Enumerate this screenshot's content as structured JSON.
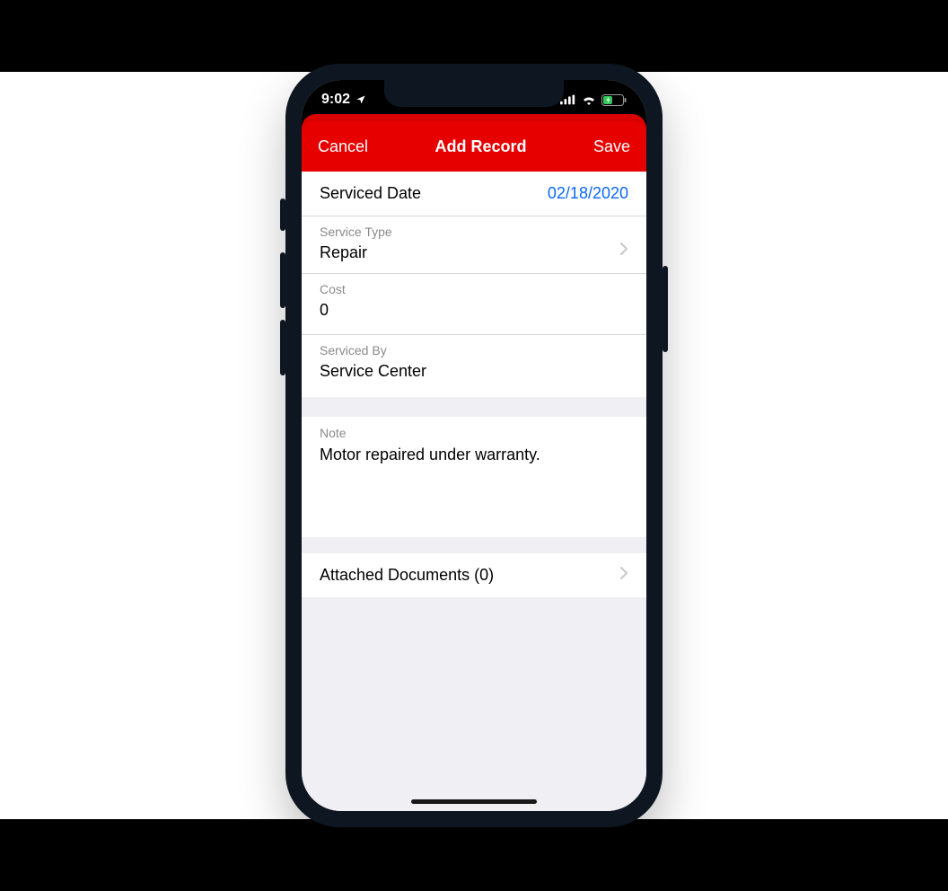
{
  "statusbar": {
    "time": "9:02"
  },
  "nav": {
    "cancel_label": "Cancel",
    "title": "Add Record",
    "save_label": "Save"
  },
  "fields": {
    "serviced_date": {
      "label": "Serviced Date",
      "value": "02/18/2020"
    },
    "service_type": {
      "label": "Service Type",
      "value": "Repair"
    },
    "cost": {
      "label": "Cost",
      "value": "0"
    },
    "serviced_by": {
      "label": "Serviced By",
      "value": "Service Center"
    },
    "note": {
      "label": "Note",
      "value": "Motor repaired under warranty."
    },
    "attached": {
      "label": "Attached Documents (0)"
    }
  }
}
